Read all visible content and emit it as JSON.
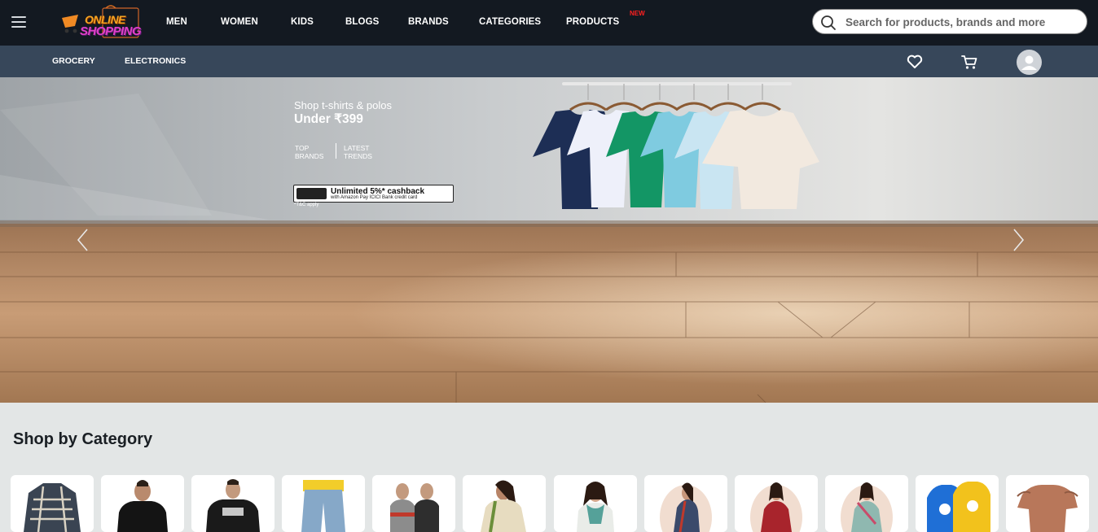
{
  "brand": {
    "line1": "ONLINE",
    "line2": "SHOPPING"
  },
  "nav": {
    "items": [
      "MEN",
      "WOMEN",
      "KIDS",
      "BLOGS",
      "BRANDS",
      "CATEGORIES",
      "PRODUCTS"
    ],
    "new_badge": "NEW"
  },
  "search": {
    "placeholder": "Search for products, brands and more",
    "value": ""
  },
  "subnav": {
    "items": [
      "GROCERY",
      "ELECTRONICS"
    ]
  },
  "icons": {
    "menu": "hamburger-icon",
    "wishlist": "heart-icon",
    "cart": "cart-icon",
    "account": "user-icon",
    "search": "search-icon",
    "prev": "chevron-left-icon",
    "next": "chevron-right-icon"
  },
  "hero": {
    "line1": "Shop t-shirts & polos",
    "line2": "Under ₹399",
    "tag1": "TOP\nBRANDS",
    "tag2": "LATEST\nTRENDS",
    "cashback_title": "Unlimited 5%* cashback",
    "cashback_sub": "with Amazon Pay ICICI Bank credit card",
    "tnc": "*T&C apply"
  },
  "category_section": {
    "title": "Shop by Category",
    "items": [
      "shirt",
      "polo",
      "tshirt",
      "jeans",
      "vests",
      "saree",
      "scarf-top",
      "saree-drape",
      "kurti",
      "ethnic-set",
      "kids-sweatshirt",
      "top"
    ]
  },
  "colors": {
    "topbar": "#131921",
    "subbar": "#37475a",
    "page_bg": "#e3e6e6",
    "new_badge": "#ff2020"
  }
}
